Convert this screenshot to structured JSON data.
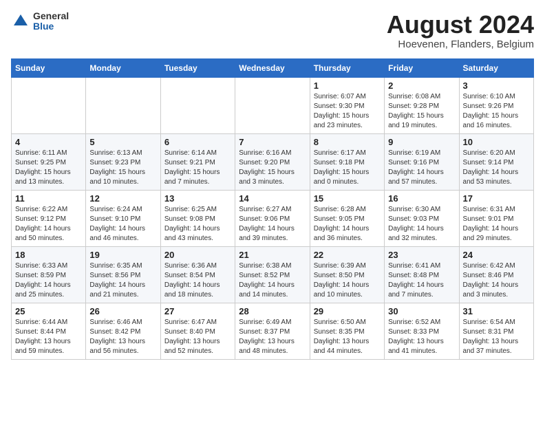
{
  "header": {
    "logo_general": "General",
    "logo_blue": "Blue",
    "title": "August 2024",
    "location": "Hoevenen, Flanders, Belgium"
  },
  "calendar": {
    "days_of_week": [
      "Sunday",
      "Monday",
      "Tuesday",
      "Wednesday",
      "Thursday",
      "Friday",
      "Saturday"
    ],
    "weeks": [
      [
        {
          "day": "",
          "info": ""
        },
        {
          "day": "",
          "info": ""
        },
        {
          "day": "",
          "info": ""
        },
        {
          "day": "",
          "info": ""
        },
        {
          "day": "1",
          "info": "Sunrise: 6:07 AM\nSunset: 9:30 PM\nDaylight: 15 hours\nand 23 minutes."
        },
        {
          "day": "2",
          "info": "Sunrise: 6:08 AM\nSunset: 9:28 PM\nDaylight: 15 hours\nand 19 minutes."
        },
        {
          "day": "3",
          "info": "Sunrise: 6:10 AM\nSunset: 9:26 PM\nDaylight: 15 hours\nand 16 minutes."
        }
      ],
      [
        {
          "day": "4",
          "info": "Sunrise: 6:11 AM\nSunset: 9:25 PM\nDaylight: 15 hours\nand 13 minutes."
        },
        {
          "day": "5",
          "info": "Sunrise: 6:13 AM\nSunset: 9:23 PM\nDaylight: 15 hours\nand 10 minutes."
        },
        {
          "day": "6",
          "info": "Sunrise: 6:14 AM\nSunset: 9:21 PM\nDaylight: 15 hours\nand 7 minutes."
        },
        {
          "day": "7",
          "info": "Sunrise: 6:16 AM\nSunset: 9:20 PM\nDaylight: 15 hours\nand 3 minutes."
        },
        {
          "day": "8",
          "info": "Sunrise: 6:17 AM\nSunset: 9:18 PM\nDaylight: 15 hours\nand 0 minutes."
        },
        {
          "day": "9",
          "info": "Sunrise: 6:19 AM\nSunset: 9:16 PM\nDaylight: 14 hours\nand 57 minutes."
        },
        {
          "day": "10",
          "info": "Sunrise: 6:20 AM\nSunset: 9:14 PM\nDaylight: 14 hours\nand 53 minutes."
        }
      ],
      [
        {
          "day": "11",
          "info": "Sunrise: 6:22 AM\nSunset: 9:12 PM\nDaylight: 14 hours\nand 50 minutes."
        },
        {
          "day": "12",
          "info": "Sunrise: 6:24 AM\nSunset: 9:10 PM\nDaylight: 14 hours\nand 46 minutes."
        },
        {
          "day": "13",
          "info": "Sunrise: 6:25 AM\nSunset: 9:08 PM\nDaylight: 14 hours\nand 43 minutes."
        },
        {
          "day": "14",
          "info": "Sunrise: 6:27 AM\nSunset: 9:06 PM\nDaylight: 14 hours\nand 39 minutes."
        },
        {
          "day": "15",
          "info": "Sunrise: 6:28 AM\nSunset: 9:05 PM\nDaylight: 14 hours\nand 36 minutes."
        },
        {
          "day": "16",
          "info": "Sunrise: 6:30 AM\nSunset: 9:03 PM\nDaylight: 14 hours\nand 32 minutes."
        },
        {
          "day": "17",
          "info": "Sunrise: 6:31 AM\nSunset: 9:01 PM\nDaylight: 14 hours\nand 29 minutes."
        }
      ],
      [
        {
          "day": "18",
          "info": "Sunrise: 6:33 AM\nSunset: 8:59 PM\nDaylight: 14 hours\nand 25 minutes."
        },
        {
          "day": "19",
          "info": "Sunrise: 6:35 AM\nSunset: 8:56 PM\nDaylight: 14 hours\nand 21 minutes."
        },
        {
          "day": "20",
          "info": "Sunrise: 6:36 AM\nSunset: 8:54 PM\nDaylight: 14 hours\nand 18 minutes."
        },
        {
          "day": "21",
          "info": "Sunrise: 6:38 AM\nSunset: 8:52 PM\nDaylight: 14 hours\nand 14 minutes."
        },
        {
          "day": "22",
          "info": "Sunrise: 6:39 AM\nSunset: 8:50 PM\nDaylight: 14 hours\nand 10 minutes."
        },
        {
          "day": "23",
          "info": "Sunrise: 6:41 AM\nSunset: 8:48 PM\nDaylight: 14 hours\nand 7 minutes."
        },
        {
          "day": "24",
          "info": "Sunrise: 6:42 AM\nSunset: 8:46 PM\nDaylight: 14 hours\nand 3 minutes."
        }
      ],
      [
        {
          "day": "25",
          "info": "Sunrise: 6:44 AM\nSunset: 8:44 PM\nDaylight: 13 hours\nand 59 minutes."
        },
        {
          "day": "26",
          "info": "Sunrise: 6:46 AM\nSunset: 8:42 PM\nDaylight: 13 hours\nand 56 minutes."
        },
        {
          "day": "27",
          "info": "Sunrise: 6:47 AM\nSunset: 8:40 PM\nDaylight: 13 hours\nand 52 minutes."
        },
        {
          "day": "28",
          "info": "Sunrise: 6:49 AM\nSunset: 8:37 PM\nDaylight: 13 hours\nand 48 minutes."
        },
        {
          "day": "29",
          "info": "Sunrise: 6:50 AM\nSunset: 8:35 PM\nDaylight: 13 hours\nand 44 minutes."
        },
        {
          "day": "30",
          "info": "Sunrise: 6:52 AM\nSunset: 8:33 PM\nDaylight: 13 hours\nand 41 minutes."
        },
        {
          "day": "31",
          "info": "Sunrise: 6:54 AM\nSunset: 8:31 PM\nDaylight: 13 hours\nand 37 minutes."
        }
      ]
    ]
  }
}
